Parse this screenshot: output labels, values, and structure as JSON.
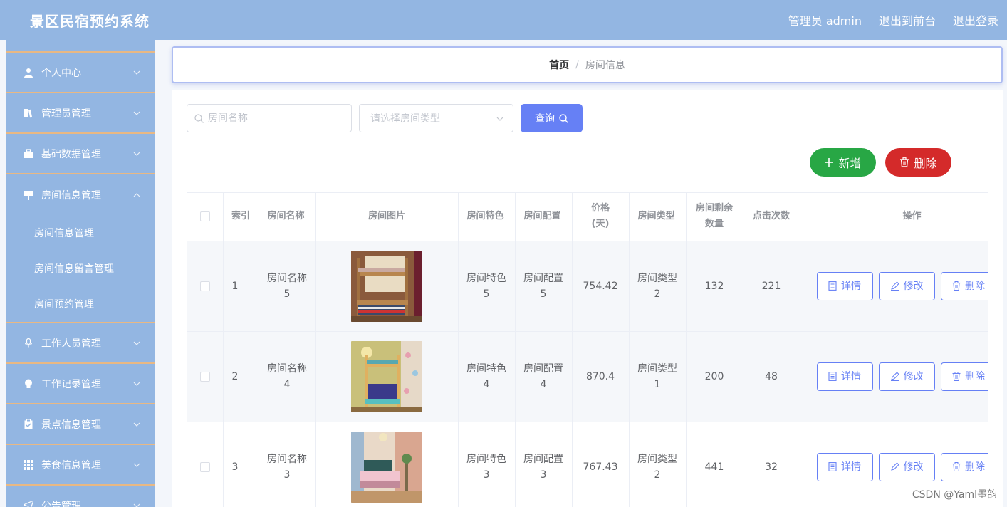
{
  "header": {
    "title": "景区民宿预约系统",
    "admin_label": "管理员 admin",
    "front_label": "退出到前台",
    "logout_label": "退出登录"
  },
  "sidebar": {
    "items": [
      {
        "label": "个人中心",
        "icon": "user-icon"
      },
      {
        "label": "管理员管理",
        "icon": "books-icon"
      },
      {
        "label": "基础数据管理",
        "icon": "briefcase-icon"
      },
      {
        "label": "房间信息管理",
        "icon": "sign-icon",
        "open": true,
        "children": [
          {
            "label": "房间信息管理"
          },
          {
            "label": "房间信息留言管理"
          },
          {
            "label": "房间预约管理"
          }
        ]
      },
      {
        "label": "工作人员管理",
        "icon": "microphone-icon"
      },
      {
        "label": "工作记录管理",
        "icon": "lightbulb-icon"
      },
      {
        "label": "景点信息管理",
        "icon": "clipboard-icon"
      },
      {
        "label": "美食信息管理",
        "icon": "grid-icon"
      },
      {
        "label": "公告管理",
        "icon": "send-icon"
      }
    ]
  },
  "breadcrumb": {
    "home": "首页",
    "separator": "/",
    "current": "房间信息"
  },
  "search": {
    "name_placeholder": "房间名称",
    "type_placeholder": "请选择房间类型",
    "query_label": "查询"
  },
  "actions": {
    "add_label": "新增",
    "delete_label": "删除"
  },
  "table": {
    "headers": {
      "index": "索引",
      "name": "房间名称",
      "image": "房间图片",
      "feature": "房间特色",
      "config": "房间配置",
      "price": "价格(天)",
      "type": "房间类型",
      "remaining": "房间剩余数量",
      "clicks": "点击次数",
      "ops": "操作"
    },
    "rows": [
      {
        "index": "1",
        "name": "房间名称5",
        "feature": "房间特色5",
        "config": "房间配置5",
        "price": "754.42",
        "type": "房间类型2",
        "remaining": "132",
        "clicks": "221"
      },
      {
        "index": "2",
        "name": "房间名称4",
        "feature": "房间特色4",
        "config": "房间配置4",
        "price": "870.4",
        "type": "房间类型1",
        "remaining": "200",
        "clicks": "48"
      },
      {
        "index": "3",
        "name": "房间名称3",
        "feature": "房间特色3",
        "config": "房间配置3",
        "price": "767.43",
        "type": "房间类型2",
        "remaining": "441",
        "clicks": "32"
      }
    ],
    "row_actions": {
      "detail": "详情",
      "edit": "修改",
      "delete": "删除"
    }
  },
  "watermark": "CSDN @Yaml墨韵",
  "colors": {
    "header_bg": "#93b6e2",
    "sidebar_bg": "#93b6e2",
    "sidebar_divider": "#e8b884",
    "primary": "#6680f5",
    "success": "#28a745",
    "danger": "#d42a2a"
  }
}
